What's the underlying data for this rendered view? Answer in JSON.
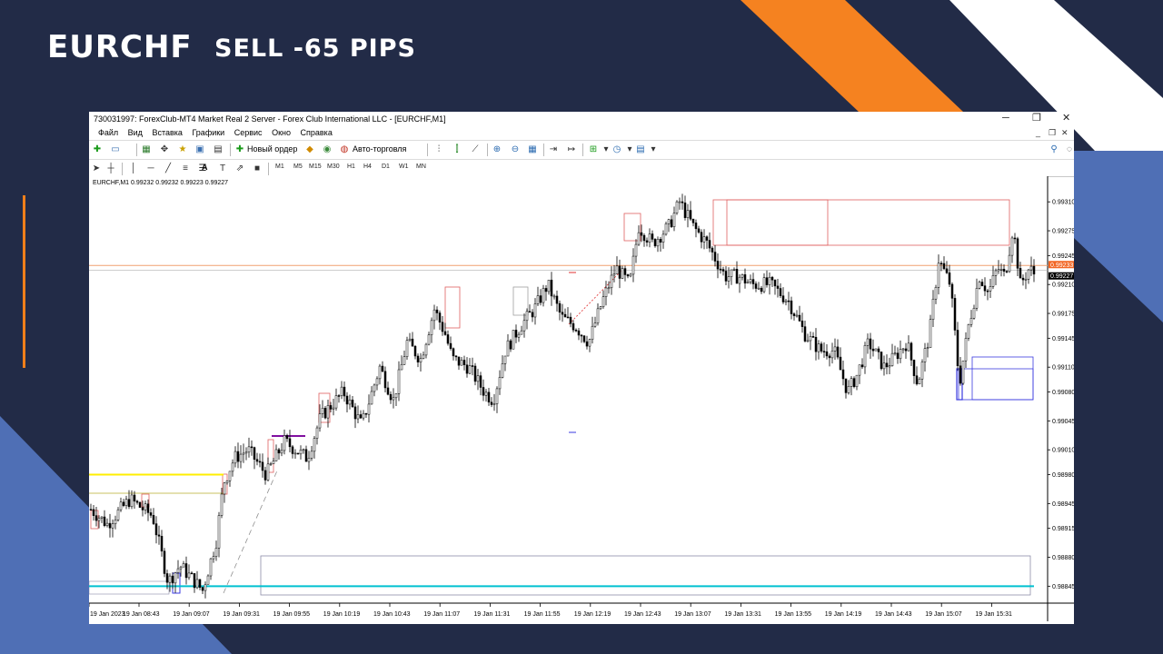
{
  "slide": {
    "title": "EURCHF",
    "subtitle": "SELL -65 PIPS",
    "colors": {
      "background": "#222b47",
      "orange": "#f58220",
      "blue": "#4f6fb5",
      "white": "#ffffff",
      "accent_line": "#f07f1a"
    }
  },
  "window": {
    "title": "730031997: ForexClub-MT4 Market Real 2 Server - Forex Club International LLC - [EURCHF,M1]",
    "controls": [
      "─",
      "❐",
      "✕"
    ]
  },
  "menu": {
    "items": [
      "Файл",
      "Вид",
      "Вставка",
      "Графики",
      "Сервис",
      "Окно",
      "Справка"
    ],
    "mdi_controls": [
      "_",
      "❐",
      "✕"
    ]
  },
  "toolbar": {
    "new_order": "Новый ордер",
    "auto_trading": "Авто-торговля",
    "timeframes": [
      "M1",
      "M5",
      "M15",
      "M30",
      "H1",
      "H4",
      "D1",
      "W1",
      "MN"
    ],
    "draw_text_tool": "A"
  },
  "chart_data": {
    "type": "candlestick",
    "symbol_header": "EURCHF,M1  0.99232 0.99232 0.99223 0.99227",
    "price_labels": [
      "0.99310",
      "0.99275",
      "0.99245",
      "0.99210",
      "0.99175",
      "0.99145",
      "0.99110",
      "0.99080",
      "0.99045",
      "0.99010",
      "0.98980",
      "0.98945",
      "0.98915",
      "0.98880",
      "0.98845"
    ],
    "ylim": [
      0.9883,
      0.9933
    ],
    "time_labels": [
      "19 Jan 2023",
      "19 Jan 08:43",
      "19 Jan 09:07",
      "19 Jan 09:31",
      "19 Jan 09:55",
      "19 Jan 10:19",
      "19 Jan 10:43",
      "19 Jan 11:07",
      "19 Jan 11:31",
      "19 Jan 11:55",
      "19 Jan 12:19",
      "19 Jan 12:43",
      "19 Jan 13:07",
      "19 Jan 13:31",
      "19 Jan 13:55",
      "19 Jan 14:19",
      "19 Jan 14:43",
      "19 Jan 15:07",
      "19 Jan 15:31"
    ],
    "ask_marker": "0.99233",
    "bid_marker": "0.99227",
    "ask_level": 0.99233,
    "bid_level": 0.99227,
    "horizontal_levels": [
      {
        "price": 0.9898,
        "color": "#ffee00"
      },
      {
        "price": 0.98845,
        "color": "#00c0d0"
      }
    ],
    "price_path": [
      [
        0,
        0.9894
      ],
      [
        20,
        0.9892
      ],
      [
        45,
        0.9895
      ],
      [
        70,
        0.9893
      ],
      [
        87,
        0.9885
      ],
      [
        100,
        0.9887
      ],
      [
        125,
        0.9884
      ],
      [
        140,
        0.989
      ],
      [
        148,
        0.9897
      ],
      [
        160,
        0.99
      ],
      [
        175,
        0.9901
      ],
      [
        195,
        0.9898
      ],
      [
        215,
        0.9902
      ],
      [
        240,
        0.99
      ],
      [
        255,
        0.9905
      ],
      [
        280,
        0.9908
      ],
      [
        300,
        0.9904
      ],
      [
        320,
        0.9911
      ],
      [
        335,
        0.9907
      ],
      [
        350,
        0.9914
      ],
      [
        365,
        0.9912
      ],
      [
        380,
        0.9918
      ],
      [
        392,
        0.9915
      ],
      [
        400,
        0.9912
      ],
      [
        418,
        0.9911
      ],
      [
        435,
        0.9908
      ],
      [
        445,
        0.9907
      ],
      [
        458,
        0.9913
      ],
      [
        475,
        0.9916
      ],
      [
        490,
        0.9918
      ],
      [
        505,
        0.9921
      ],
      [
        520,
        0.9917
      ],
      [
        535,
        0.9916
      ],
      [
        550,
        0.9914
      ],
      [
        565,
        0.9919
      ],
      [
        580,
        0.9923
      ],
      [
        595,
        0.9921
      ],
      [
        605,
        0.9928
      ],
      [
        620,
        0.9926
      ],
      [
        638,
        0.9928
      ],
      [
        650,
        0.9931
      ],
      [
        665,
        0.9928
      ],
      [
        680,
        0.9926
      ],
      [
        690,
        0.9924
      ],
      [
        700,
        0.9922
      ],
      [
        715,
        0.9922
      ],
      [
        730,
        0.9921
      ],
      [
        750,
        0.9921
      ],
      [
        770,
        0.9919
      ],
      [
        788,
        0.9915
      ],
      [
        805,
        0.9913
      ],
      [
        820,
        0.9913
      ],
      [
        835,
        0.9908
      ],
      [
        845,
        0.991
      ],
      [
        858,
        0.9914
      ],
      [
        875,
        0.9911
      ],
      [
        885,
        0.9912
      ],
      [
        900,
        0.9914
      ],
      [
        912,
        0.9909
      ],
      [
        925,
        0.9915
      ],
      [
        935,
        0.9924
      ],
      [
        948,
        0.9921
      ],
      [
        958,
        0.9909
      ],
      [
        968,
        0.9916
      ],
      [
        980,
        0.9922
      ],
      [
        990,
        0.992
      ],
      [
        1000,
        0.9923
      ],
      [
        1008,
        0.9922
      ],
      [
        1017,
        0.9928
      ],
      [
        1025,
        0.9921
      ],
      [
        1035,
        0.9923
      ],
      [
        1042,
        0.9922
      ]
    ]
  }
}
